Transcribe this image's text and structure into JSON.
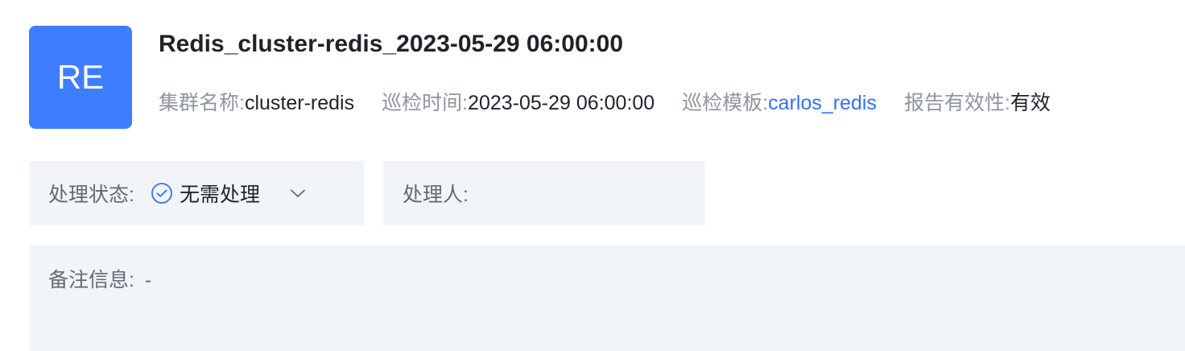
{
  "avatar": {
    "text": "RE",
    "color": "#3d7eff"
  },
  "report": {
    "title": "Redis_cluster-redis_2023-05-29 06:00:00",
    "meta": {
      "cluster_label": "集群名称:",
      "cluster_value": "cluster-redis",
      "time_label": "巡检时间:",
      "time_value": "2023-05-29 06:00:00",
      "template_label": "巡检模板:",
      "template_value": "carlos_redis",
      "validity_label": "报告有效性:",
      "validity_value": "有效"
    }
  },
  "status": {
    "label": "处理状态:",
    "value": "无需处理",
    "icon": "check-circle-icon",
    "dropdown_icon": "chevron-down-icon"
  },
  "handler": {
    "label": "处理人:",
    "value": ""
  },
  "remark": {
    "label": "备注信息:",
    "value": "-"
  },
  "colors": {
    "accent": "#3370ff",
    "panel_bg": "#f2f5f8",
    "label_gray": "#8f959e"
  }
}
